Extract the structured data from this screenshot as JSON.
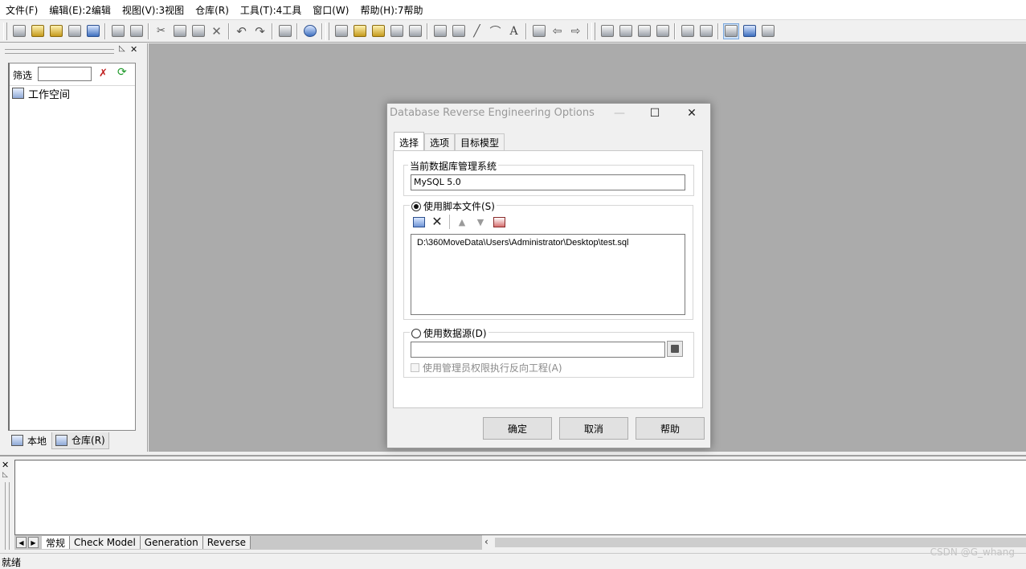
{
  "menu": [
    "文件(F)",
    "编辑(E):2编辑",
    "视图(V):3视图",
    "仓库(R)",
    "工具(T):4工具",
    "窗口(W)",
    "帮助(H):7帮助"
  ],
  "left_panel": {
    "filter_label": "筛选",
    "filter_value": "",
    "tree_root": "工作空间",
    "tab_local": "本地",
    "tab_repository": "仓库(R)"
  },
  "dialog": {
    "title": "Database Reverse Engineering Options",
    "tabs": [
      "选择",
      "选项",
      "目标模型"
    ],
    "active_tab": "选择",
    "dbms_group_label": "当前数据库管理系统",
    "dbms_value": "MySQL 5.0",
    "use_script_label": "使用脚本文件(S)",
    "use_script_selected": true,
    "script_files": [
      "D:\\360MoveData\\Users\\Administrator\\Desktop\\test.sql"
    ],
    "use_datasource_label": "使用数据源(D)",
    "use_datasource_selected": false,
    "datasource_value": "",
    "admin_checkbox_label": "使用管理员权限执行反向工程(A)",
    "admin_checked": false,
    "ok_label": "确定",
    "cancel_label": "取消",
    "help_label": "帮助"
  },
  "output_tabs": [
    "常规",
    "Check Model",
    "Generation",
    "Reverse"
  ],
  "output_active_tab": "常规",
  "status_text": "就绪",
  "watermark": "CSDN @G_whang",
  "icons": [
    "new-icon",
    "open-icon",
    "save-icon",
    "print-icon",
    "cut-icon",
    "copy-icon",
    "paste-icon",
    "delete-icon",
    "undo-icon",
    "redo-icon",
    "filter-clear-icon",
    "refresh-icon",
    "workspace-icon",
    "add-file-icon",
    "remove-icon",
    "move-up-icon",
    "move-down-icon",
    "clear-list-icon",
    "browse-datasource-icon"
  ],
  "colors": {
    "workspace_bg": "#ababab",
    "active_toolbar_button": "#cfe3fa"
  }
}
